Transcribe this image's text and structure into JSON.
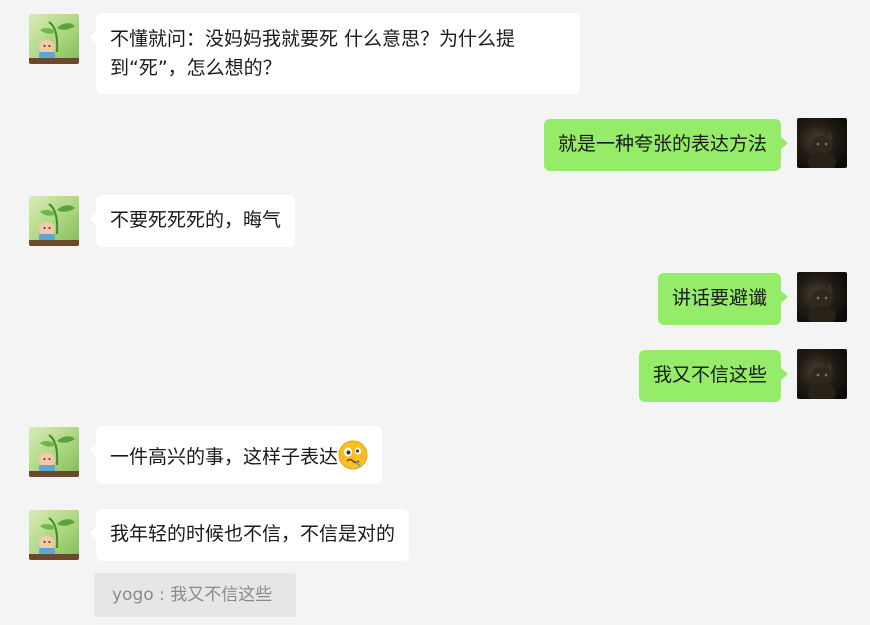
{
  "chat": {
    "messages": [
      {
        "side": "left",
        "lines": [
          "不懂就问：没妈妈我就要死  什么意思？为什么提",
          "到“死”，怎么想的？"
        ]
      },
      {
        "side": "right",
        "text": "就是一种夸张的表达方法"
      },
      {
        "side": "left",
        "text": "不要死死死的，晦气"
      },
      {
        "side": "right",
        "text": "讲话要避谶"
      },
      {
        "side": "right",
        "text": "我又不信这些"
      },
      {
        "side": "left",
        "text": "一件高兴的事，这样子表达",
        "emoji": "woozy-face"
      },
      {
        "side": "left",
        "text": "我年轻的时候也不信，不信是对的"
      }
    ],
    "quote": {
      "text": "yogo : 我又不信这些"
    }
  },
  "colors": {
    "background": "#f4f4f4",
    "bubble_left": "#ffffff",
    "bubble_right": "#95ec69",
    "quote_bg": "#e6e6e6",
    "quote_text": "#8a8a8a"
  },
  "avatars": {
    "contact": "sprout-figure-avatar",
    "self": "dark-cat-avatar"
  }
}
